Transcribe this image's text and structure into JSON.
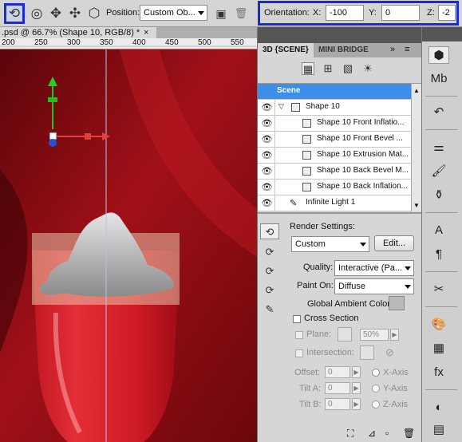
{
  "options_bar": {
    "tools": [
      {
        "icon": "3d-rotate-icon",
        "active": true
      },
      {
        "icon": "3d-roll-icon"
      },
      {
        "icon": "3d-pan-icon"
      },
      {
        "icon": "3d-slide-icon"
      },
      {
        "icon": "3d-scale-icon"
      }
    ],
    "position_label": "Position:",
    "position_value": "Custom Ob...",
    "orientation_label": "Orientation:",
    "x_label": "X:",
    "x_value": "-100",
    "y_label": "Y:",
    "y_value": "0",
    "z_label": "Z:",
    "z_value": "-2"
  },
  "document": {
    "tab_title": ".psd @ 66.7% (Shape 10, RGB/8) *",
    "ruler_ticks": [
      "200",
      "250",
      "300",
      "350",
      "400",
      "450",
      "500",
      "550"
    ]
  },
  "panel": {
    "tabs": [
      "3D {SCENE}",
      "MINI BRIDGE"
    ],
    "layers": [
      {
        "name": "Scene",
        "selected": true
      },
      {
        "name": "Shape 10"
      },
      {
        "name": "Shape 10 Front Inflatio..."
      },
      {
        "name": "Shape 10 Front Bevel ..."
      },
      {
        "name": "Shape 10 Extrusion Mat..."
      },
      {
        "name": "Shape 10 Back Bevel M..."
      },
      {
        "name": "Shape 10 Back Inflation..."
      },
      {
        "name": "Infinite Light 1"
      }
    ],
    "render_settings_label": "Render Settings:",
    "render_value": "Custom",
    "edit_label": "Edit...",
    "quality_label": "Quality:",
    "quality_value": "Interactive (Pa...",
    "paint_on_label": "Paint On:",
    "paint_on_value": "Diffuse",
    "ambient_label": "Global Ambient Color:",
    "cross_section_label": "Cross Section",
    "plane_label": "Plane:",
    "plane_opacity": "50%",
    "intersection_label": "Intersection:",
    "offset_label": "Offset:",
    "offset_value": "0",
    "tilt_a_label": "Tilt A:",
    "tilt_a_value": "0",
    "tilt_b_label": "Tilt B:",
    "tilt_b_value": "0",
    "x_axis_label": "X-Axis",
    "y_axis_label": "Y-Axis",
    "z_axis_label": "Z-Axis"
  },
  "colors": {
    "highlight_box": "#1a2ad8",
    "selected_layer": "#3d8ee8",
    "canvas_red": "#8a0c14"
  }
}
